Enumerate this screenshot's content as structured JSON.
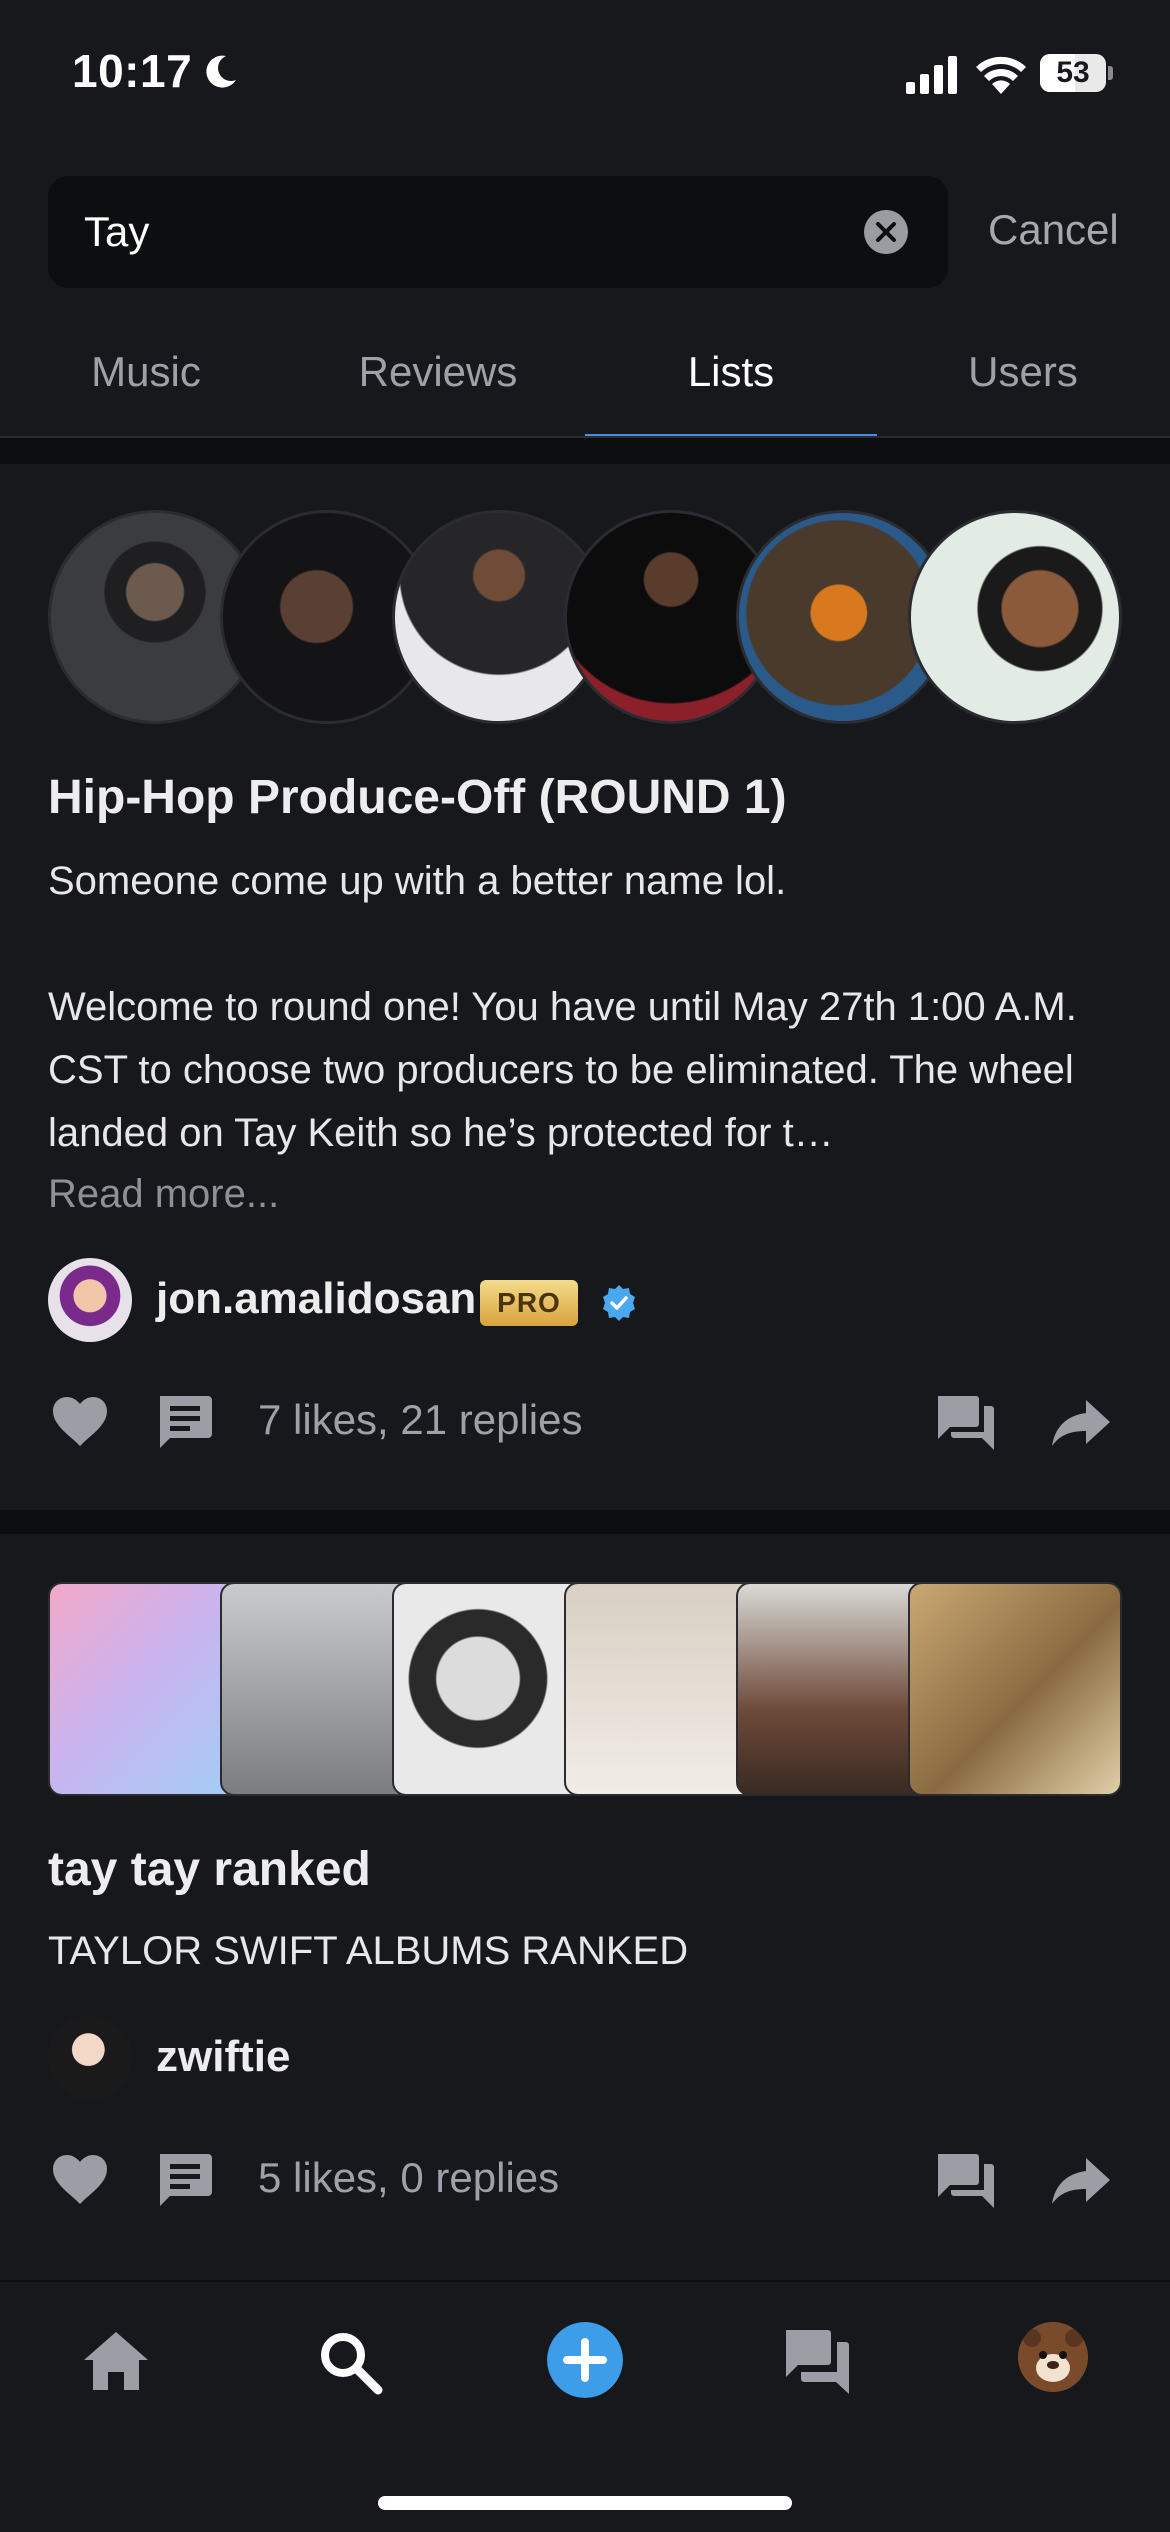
{
  "status_bar": {
    "time": "10:17",
    "battery": "53",
    "battery_level_percent": 53
  },
  "search": {
    "value": "Tay",
    "cancel_label": "Cancel"
  },
  "tabs": [
    {
      "label": "Music",
      "active": false
    },
    {
      "label": "Reviews",
      "active": false
    },
    {
      "label": "Lists",
      "active": true
    },
    {
      "label": "Users",
      "active": false
    }
  ],
  "lists": [
    {
      "title": "Hip-Hop Produce-Off (ROUND 1)",
      "description": "Someone come up with a better name lol.\n\nWelcome to round one! You have until May 27th 1:00 A.M. CST to choose two producers to be eliminated. The wheel landed on Tay Keith so he’s protected for t…",
      "read_more": "Read more...",
      "author": "jon.amalidosan",
      "badge": "PRO",
      "verified": true,
      "stats": "7 likes, 21 replies"
    },
    {
      "title": "tay tay ranked",
      "description": "TAYLOR SWIFT ALBUMS RANKED",
      "author": "zwiftie",
      "stats": "5 likes, 0 replies"
    }
  ],
  "colors": {
    "background": "#17181c",
    "accent": "#4a90e2",
    "plus_button": "#3d9de8",
    "verified": "#4aa8f0"
  },
  "icons": {
    "like": "heart-icon",
    "comment": "comment-icon",
    "replies": "forum-icon",
    "share": "share-icon",
    "nav": [
      "home-icon",
      "search-icon",
      "plus-icon",
      "forum-icon",
      "profile-avatar"
    ]
  }
}
